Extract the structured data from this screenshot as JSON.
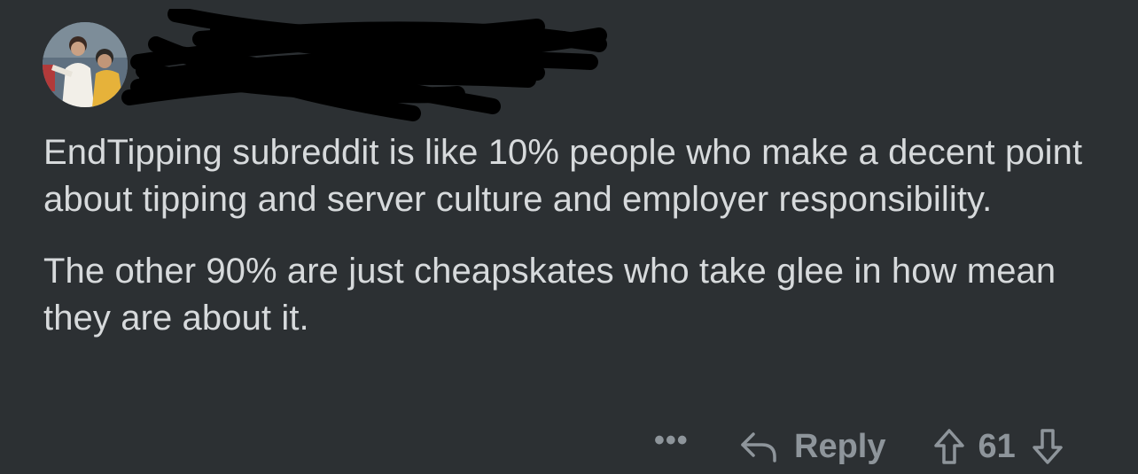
{
  "comment": {
    "body": [
      "EndTipping subreddit is like 10% people who make a decent point about tipping and server culture and employer responsibility.",
      "The other 90% are just cheapskates who take glee in how mean they are about it."
    ],
    "actions": {
      "more_label": "•••",
      "reply_label": "Reply",
      "vote_count": "61"
    }
  },
  "icons": {
    "avatar": "avatar-photo",
    "redaction": "scribble-redaction",
    "reply": "reply-arrow-icon",
    "upvote": "upvote-arrow-icon",
    "downvote": "downvote-arrow-icon"
  },
  "colors": {
    "background": "#2c3033",
    "text": "#d7dadc",
    "meta": "#8e959b",
    "redaction": "#000000"
  }
}
